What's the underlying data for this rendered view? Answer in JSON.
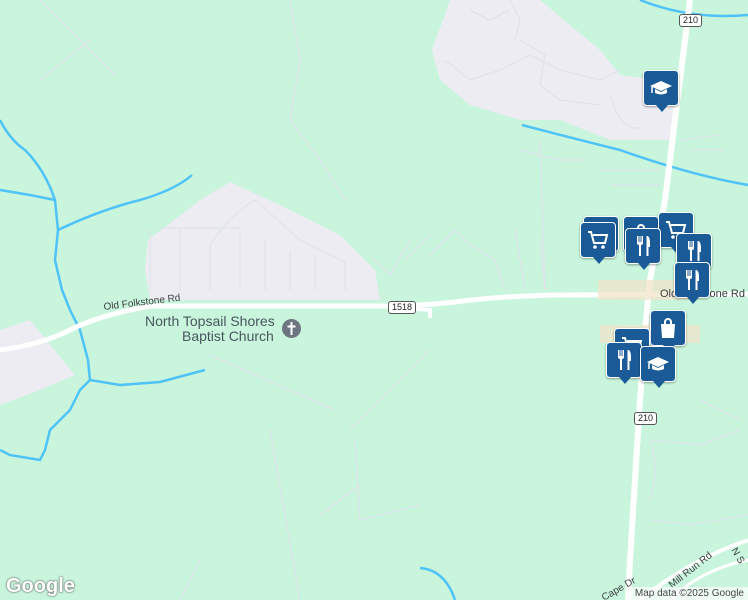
{
  "map": {
    "colors": {
      "land": "#c8f5dc",
      "water": "#4fc3f7",
      "urban": "#ececf2",
      "road": "#ffffff",
      "minor_road": "#dfe4ea",
      "poi": "#1a5a96"
    },
    "roads": {
      "old_folkstone_rd": "Old Folkstone Rd",
      "old_folkstone_rd_east": "Old Folkstone Rd",
      "mill_run_rd": "Mill Run Rd",
      "cape_dr": "Cape Dr",
      "n_s": "N S"
    },
    "shields": {
      "route_1518": "1518",
      "route_210_north": "210",
      "route_210_south": "210"
    },
    "places": {
      "church_line1": "North Topsail Shores",
      "church_line2": "Baptist Church"
    },
    "pois": [
      {
        "type": "school",
        "icon": "graduation-cap-icon"
      },
      {
        "type": "shopping",
        "icon": "shopping-cart-icon"
      },
      {
        "type": "shopping",
        "icon": "shopping-bag-icon"
      },
      {
        "type": "shopping",
        "icon": "shopping-cart-icon"
      },
      {
        "type": "restaurant",
        "icon": "fork-knife-icon"
      },
      {
        "type": "restaurant",
        "icon": "fork-knife-icon"
      },
      {
        "type": "restaurant",
        "icon": "fork-knife-icon"
      },
      {
        "type": "shopping",
        "icon": "shopping-bag-icon"
      },
      {
        "type": "shopping",
        "icon": "shopping-cart-icon"
      },
      {
        "type": "restaurant",
        "icon": "fork-knife-icon"
      },
      {
        "type": "school",
        "icon": "graduation-cap-icon"
      }
    ],
    "attribution": "Map data ©2025 Google",
    "logo": "Google"
  }
}
